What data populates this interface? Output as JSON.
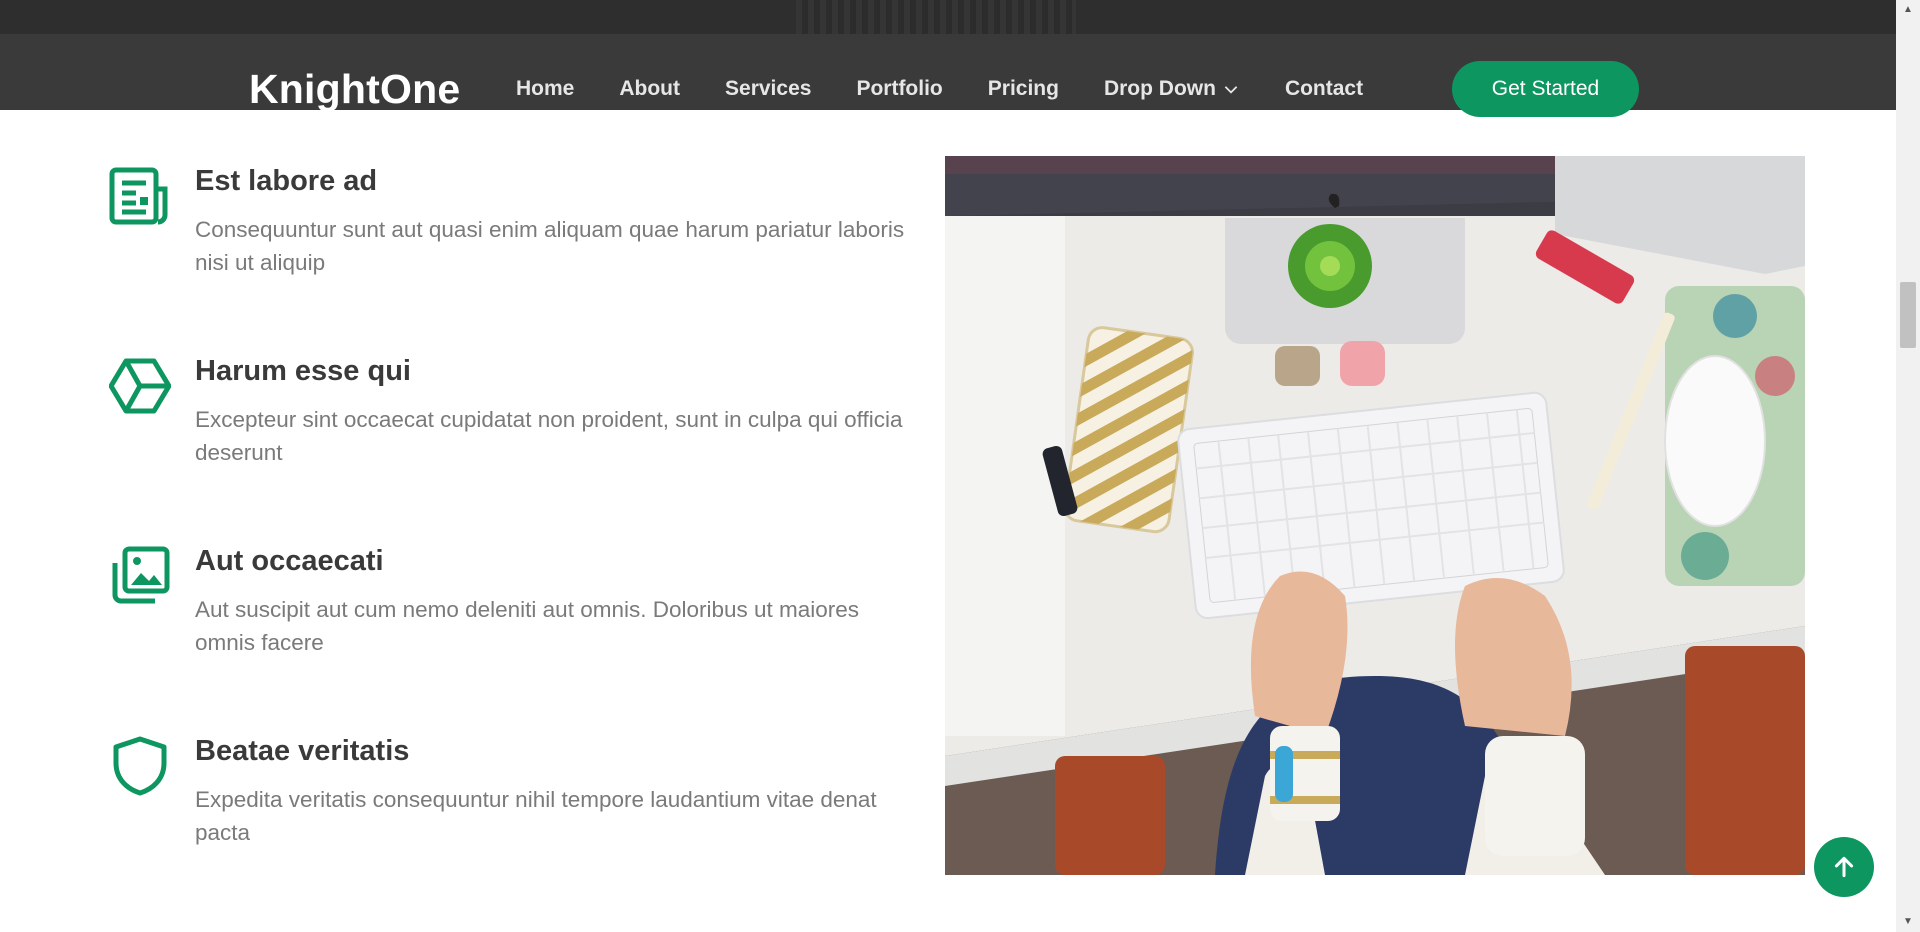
{
  "brand": {
    "name": "KnightOne"
  },
  "nav": {
    "items": [
      {
        "label": "Home"
      },
      {
        "label": "About"
      },
      {
        "label": "Services"
      },
      {
        "label": "Portfolio"
      },
      {
        "label": "Pricing"
      },
      {
        "label": "Drop Down",
        "icon": "chevron-down-icon"
      },
      {
        "label": "Contact"
      }
    ],
    "cta_label": "Get Started"
  },
  "features": [
    {
      "icon": "newspaper-icon",
      "title": "Est labore ad",
      "text": "Consequuntur sunt aut quasi enim aliquam quae harum pariatur laboris nisi ut aliquip"
    },
    {
      "icon": "cube-icon",
      "title": "Harum esse qui",
      "text": "Excepteur sint occaecat cupidatat non proident, sunt in culpa qui officia deserunt"
    },
    {
      "icon": "images-icon",
      "title": "Aut occaecati",
      "text": "Aut suscipit aut cum nemo deleniti aut omnis. Doloribus ut maiores omnis facere"
    },
    {
      "icon": "shield-icon",
      "title": "Beatae veritatis",
      "text": "Expedita veritatis consequuntur nihil tempore laudantium vitae denat pacta"
    }
  ],
  "colors": {
    "accent": "#0d9660",
    "header_bg": "#3a3a3a",
    "heading": "#3a3a3a",
    "body_text": "#7a7a7a"
  },
  "back_to_top": {
    "icon": "arrow-up-icon"
  }
}
